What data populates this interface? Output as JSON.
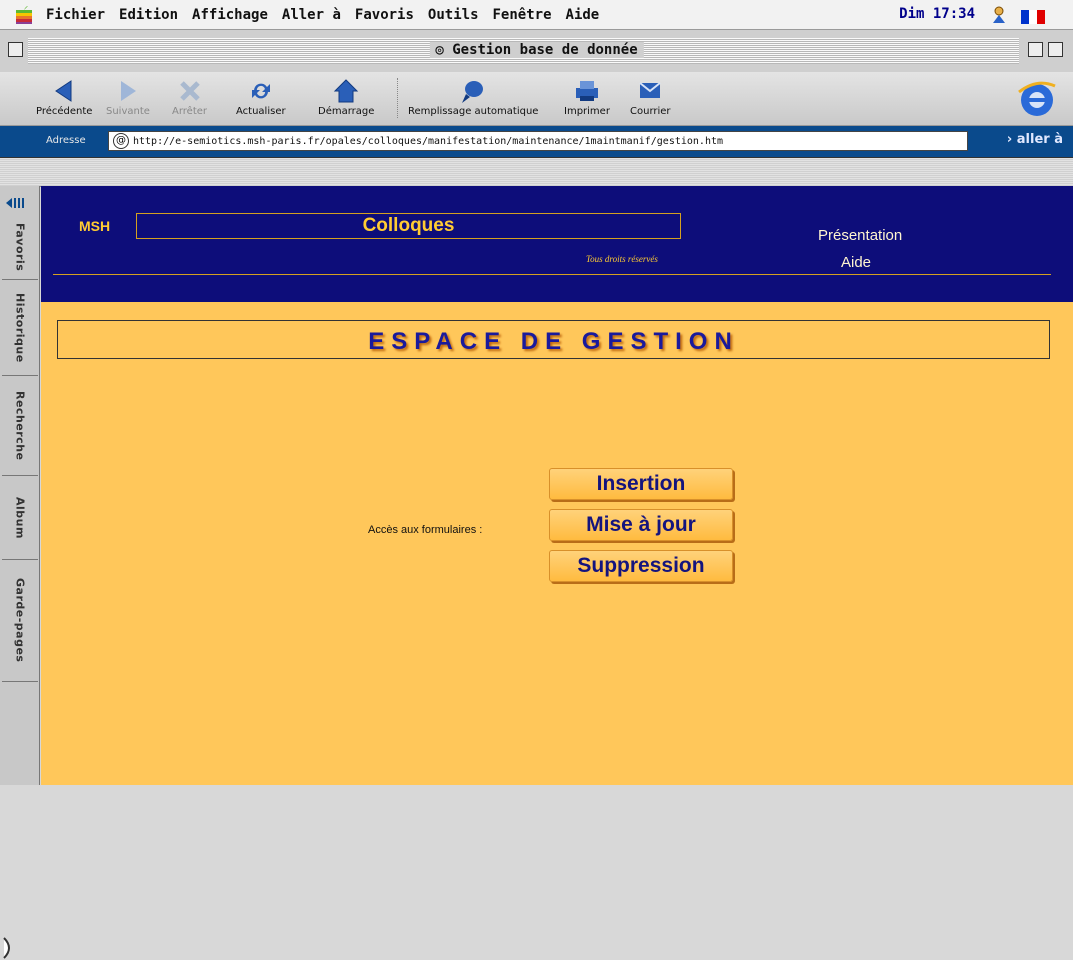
{
  "menubar": {
    "items": [
      "Fichier",
      "Edition",
      "Affichage",
      "Aller à",
      "Favoris",
      "Outils",
      "Fenêtre",
      "Aide"
    ],
    "clock": "Dim 17:34",
    "flag_colors": [
      "#0033cc",
      "#ffffff",
      "#e00000"
    ]
  },
  "window": {
    "title": "Gestion base de donnée"
  },
  "toolbar": {
    "back": "Précédente",
    "forward": "Suivante",
    "stop": "Arrêter",
    "refresh": "Actualiser",
    "home": "Démarrage",
    "autofill": "Remplissage automatique",
    "print": "Imprimer",
    "mail": "Courrier"
  },
  "address": {
    "label": "Adresse",
    "url": "http://e-semiotics.msh-paris.fr/opales/colloques/manifestation/maintenance/1maintmanif/gestion.htm",
    "go": "aller à"
  },
  "sidebar": {
    "tabs": [
      "Favoris",
      "Historique",
      "Recherche",
      "Album",
      "Garde-pages"
    ]
  },
  "page": {
    "msh": "MSH",
    "title": "Colloques",
    "rights": "Tous droits réservés",
    "nav_presentation": "Présentation",
    "nav_aide": "Aide",
    "heading": "ESPACE DE GESTION",
    "access_label": "Accès aux formulaires :",
    "buttons": {
      "insert": "Insertion",
      "update": "Mise à jour",
      "delete": "Suppression"
    },
    "colors": {
      "banner": "#0d0d7a",
      "background": "#ffc75a",
      "accent": "#ffcc33",
      "heading": "#1a1a9c"
    }
  }
}
